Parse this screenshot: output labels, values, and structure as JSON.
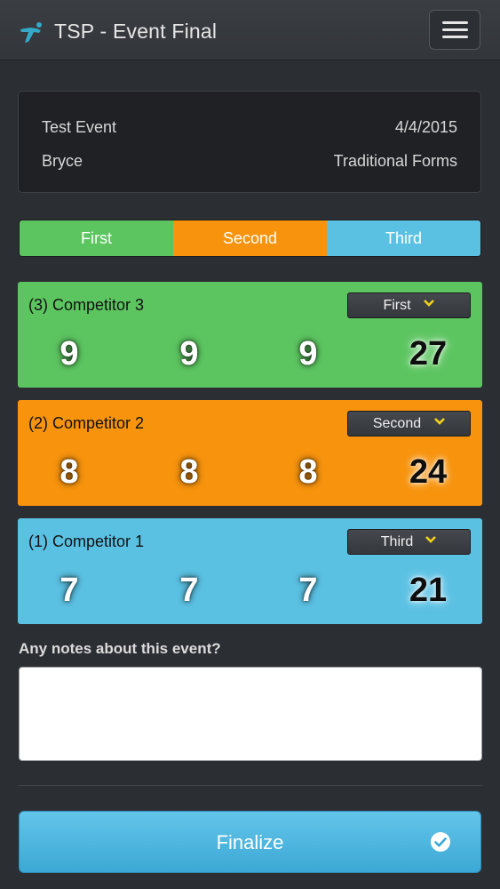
{
  "app": {
    "title": "TSP - Event Final"
  },
  "event": {
    "name": "Test Event",
    "date": "4/4/2015",
    "judge": "Bryce",
    "category": "Traditional Forms"
  },
  "place_tabs": [
    {
      "label": "First",
      "color": "#5cc560"
    },
    {
      "label": "Second",
      "color": "#f7930d"
    },
    {
      "label": "Third",
      "color": "#5bc1e3"
    }
  ],
  "competitors": [
    {
      "label": "(3) Competitor 3",
      "place": "First",
      "scores": [
        "9",
        "9",
        "9"
      ],
      "total": "27",
      "color": "#5cc560"
    },
    {
      "label": "(2) Competitor 2",
      "place": "Second",
      "scores": [
        "8",
        "8",
        "8"
      ],
      "total": "24",
      "color": "#f7930d"
    },
    {
      "label": "(1) Competitor 1",
      "place": "Third",
      "scores": [
        "7",
        "7",
        "7"
      ],
      "total": "21",
      "color": "#5bc1e3"
    }
  ],
  "notes": {
    "label": "Any notes about this event?",
    "value": "",
    "placeholder": ""
  },
  "finalize": {
    "label": "Finalize",
    "icon": "check-circle-icon"
  },
  "menu": {
    "icon": "hamburger-menu-icon"
  },
  "colors": {
    "accent_yellow": "#f2d21a",
    "background": "#2b2e33"
  }
}
